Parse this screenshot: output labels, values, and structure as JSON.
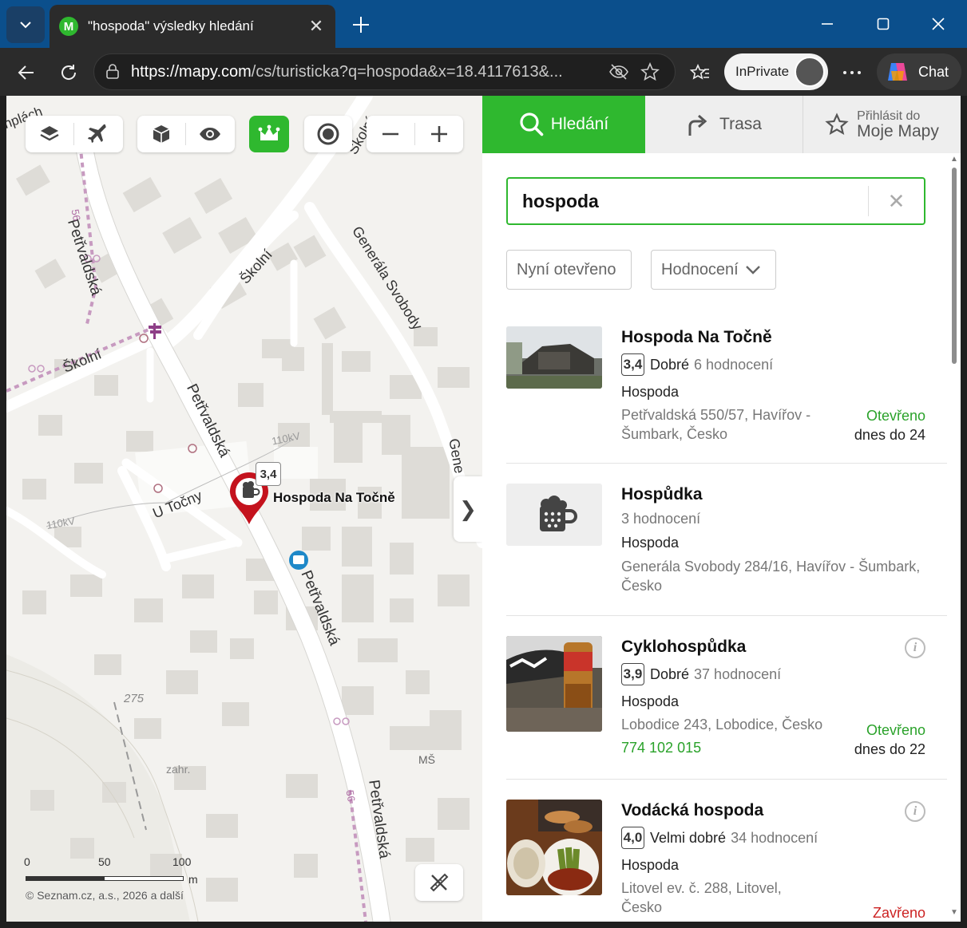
{
  "browser": {
    "tab_title": "\"hospoda\" výsledky hledání",
    "favicon_letter": "M",
    "url_host": "https://mapy.com",
    "url_rest": "/cs/turisticka?q=hospoda&x=18.4117613&...",
    "inprivate_label": "InPrivate",
    "chat_label": "Chat"
  },
  "map": {
    "labels": {
      "street_petrvaldska": "Petřvaldská",
      "street_skolni": "Školní",
      "street_generala": "Generála Svobody",
      "street_u_tocny": "U Točny",
      "street_gene_cut": "Gene",
      "street_corner": "nplách",
      "power_110": "110kV",
      "power_110_b": "110kV",
      "route_56": "56",
      "elevation": "275",
      "zahr": "zahr.",
      "ms": "MŠ"
    },
    "marker": {
      "name": "Hospoda Na Točně",
      "rating": "3,4"
    },
    "scale": {
      "t0": "0",
      "t50": "50",
      "t100": "100",
      "unit": "m"
    },
    "copyright": "© Seznam.cz, a.s., 2026 a další"
  },
  "panel": {
    "tabs": {
      "search": "Hledání",
      "route": "Trasa",
      "login_line1": "Přihlásit do",
      "login_line2": "Moje Mapy"
    },
    "search_value": "hospoda",
    "filters": {
      "open_now": "Nyní otevřeno",
      "rating": "Hodnocení"
    },
    "results": [
      {
        "name": "Hospoda Na Točně",
        "rating": "3,4",
        "rating_word": "Dobré",
        "reviews": "6 hodnocení",
        "category": "Hospoda",
        "address_line1": "Petřvaldská 550/57, Havířov -",
        "address_line2": "Šumbark, Česko",
        "status": "Otevřeno",
        "status_detail": "dnes do 24"
      },
      {
        "name": "Hospůdka",
        "reviews": "3 hodnocení",
        "category": "Hospoda",
        "address_line1": "Generála Svobody 284/16, Havířov - Šumbark,",
        "address_line2": "Česko"
      },
      {
        "name": "Cyklohospůdka",
        "rating": "3,9",
        "rating_word": "Dobré",
        "reviews": "37 hodnocení",
        "category": "Hospoda",
        "address_line1": "Lobodice 243, Lobodice, Česko",
        "phone": "774 102 015",
        "status": "Otevřeno",
        "status_detail": "dnes do 22",
        "info_glyph": "i"
      },
      {
        "name": "Vodácká hospoda",
        "rating": "4,0",
        "rating_word": "Velmi dobré",
        "reviews": "34 hodnocení",
        "category": "Hospoda",
        "address_line1": "Litovel ev. č. 288, Litovel,",
        "address_line2": "Česko",
        "status": "Zavřeno",
        "info_glyph": "i"
      }
    ]
  },
  "colors": {
    "brand_green": "#2fb82f",
    "open_green": "#2aa22a",
    "closed_red": "#cc2222"
  }
}
